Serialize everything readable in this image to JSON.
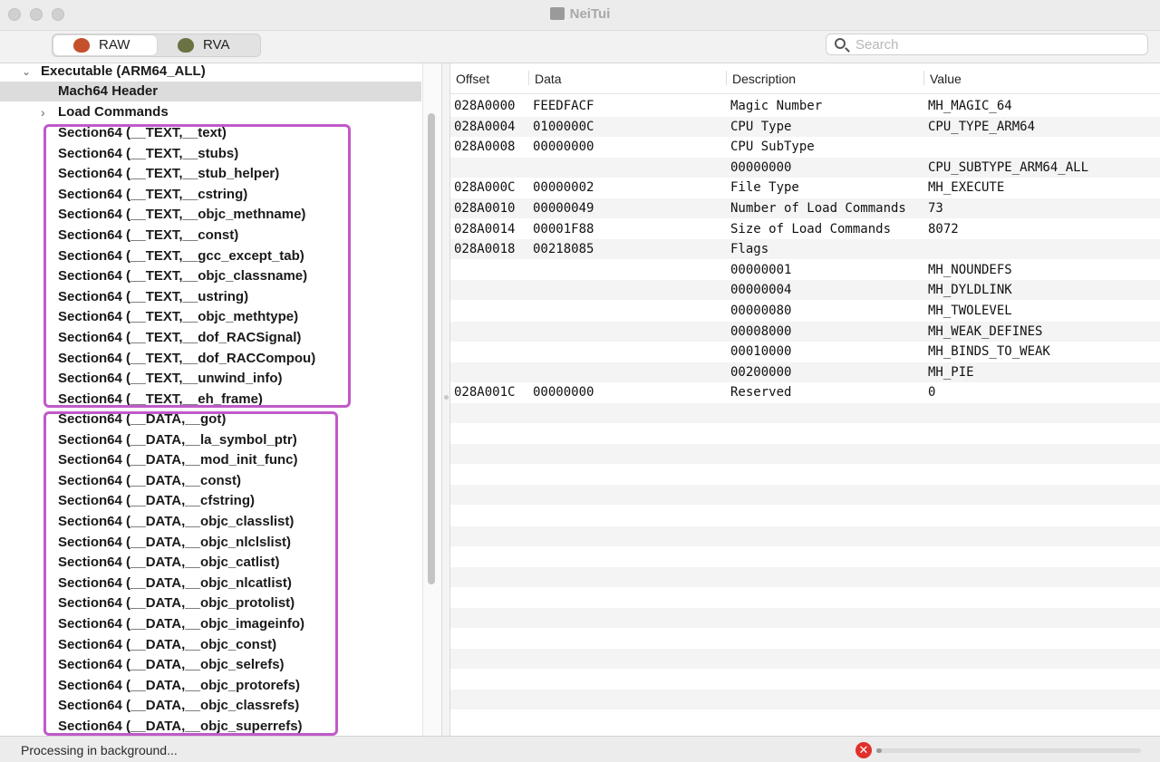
{
  "window": {
    "title": "NeiTui"
  },
  "toolbar": {
    "modes": [
      {
        "label": "RAW",
        "icon": "apple-icon",
        "active": true
      },
      {
        "label": "RVA",
        "icon": "apple-icon",
        "active": false
      }
    ],
    "search": {
      "placeholder": "Search",
      "value": ""
    }
  },
  "tree": {
    "root": {
      "label": "Executable  (ARM64_ALL)",
      "expanded": true
    },
    "header": {
      "label": "Mach64 Header",
      "selected": true
    },
    "load_commands": {
      "label": "Load Commands",
      "expanded": false
    },
    "text_sections": [
      "Section64 (__TEXT,__text)",
      "Section64 (__TEXT,__stubs)",
      "Section64 (__TEXT,__stub_helper)",
      "Section64 (__TEXT,__cstring)",
      "Section64 (__TEXT,__objc_methname)",
      "Section64 (__TEXT,__const)",
      "Section64 (__TEXT,__gcc_except_tab)",
      "Section64 (__TEXT,__objc_classname)",
      "Section64 (__TEXT,__ustring)",
      "Section64 (__TEXT,__objc_methtype)",
      "Section64 (__TEXT,__dof_RACSignal)",
      "Section64 (__TEXT,__dof_RACCompou)",
      "Section64 (__TEXT,__unwind_info)",
      "Section64 (__TEXT,__eh_frame)"
    ],
    "data_sections": [
      "Section64 (__DATA,__got)",
      "Section64 (__DATA,__la_symbol_ptr)",
      "Section64 (__DATA,__mod_init_func)",
      "Section64 (__DATA,__const)",
      "Section64 (__DATA,__cfstring)",
      "Section64 (__DATA,__objc_classlist)",
      "Section64 (__DATA,__objc_nlclslist)",
      "Section64 (__DATA,__objc_catlist)",
      "Section64 (__DATA,__objc_nlcatlist)",
      "Section64 (__DATA,__objc_protolist)",
      "Section64 (__DATA,__objc_imageinfo)",
      "Section64 (__DATA,__objc_const)",
      "Section64 (__DATA,__objc_selrefs)",
      "Section64 (__DATA,__objc_protorefs)",
      "Section64 (__DATA,__objc_classrefs)",
      "Section64 (__DATA,__objc_superrefs)"
    ],
    "highlight_color": "#c05ac8"
  },
  "table": {
    "columns": [
      "Offset",
      "Data",
      "Description",
      "Value"
    ],
    "rows": [
      [
        "028A0000",
        "FEEDFACF",
        "Magic Number",
        "MH_MAGIC_64"
      ],
      [
        "028A0004",
        "0100000C",
        "CPU Type",
        "CPU_TYPE_ARM64"
      ],
      [
        "028A0008",
        "00000000",
        "CPU SubType",
        ""
      ],
      [
        "",
        "",
        "00000000",
        "CPU_SUBTYPE_ARM64_ALL"
      ],
      [
        "028A000C",
        "00000002",
        "File Type",
        "MH_EXECUTE"
      ],
      [
        "028A0010",
        "00000049",
        "Number of Load Commands",
        "73"
      ],
      [
        "028A0014",
        "00001F88",
        "Size of Load Commands",
        "8072"
      ],
      [
        "028A0018",
        "00218085",
        "Flags",
        ""
      ],
      [
        "",
        "",
        "00000001",
        "MH_NOUNDEFS"
      ],
      [
        "",
        "",
        "00000004",
        "MH_DYLDLINK"
      ],
      [
        "",
        "",
        "00000080",
        "MH_TWOLEVEL"
      ],
      [
        "",
        "",
        "00008000",
        "MH_WEAK_DEFINES"
      ],
      [
        "",
        "",
        "00010000",
        "MH_BINDS_TO_WEAK"
      ],
      [
        "",
        "",
        "00200000",
        "MH_PIE"
      ],
      [
        "028A001C",
        "00000000",
        "Reserved",
        "0"
      ]
    ]
  },
  "status": {
    "text": "Processing in background...",
    "progress": 0.02,
    "stop_icon": "stop-icon"
  }
}
